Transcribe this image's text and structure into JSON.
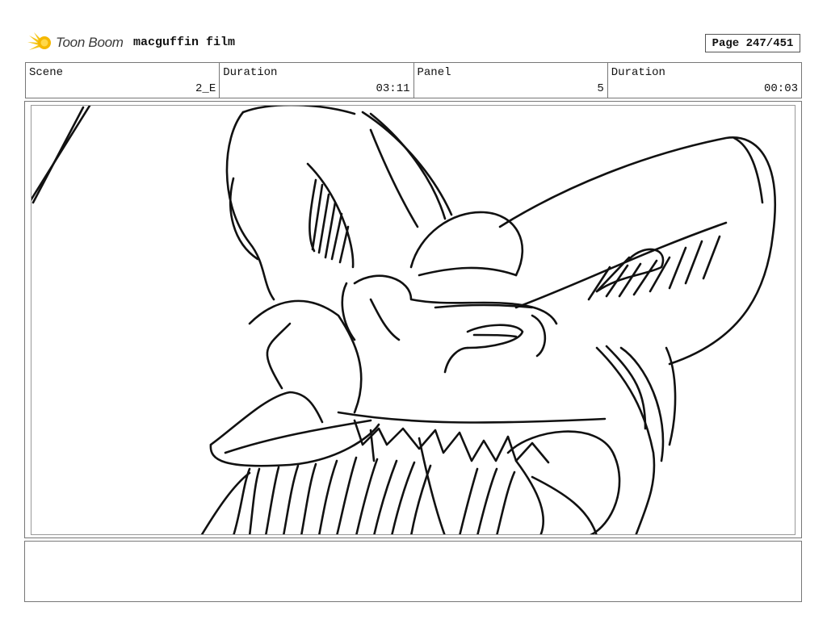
{
  "header": {
    "logo_text": "Toon Boom",
    "project_title": "macguffin film",
    "page_label": "Page 247/451"
  },
  "info": {
    "scene_label": "Scene",
    "scene_value": "2_E",
    "scene_duration_label": "Duration",
    "scene_duration_value": "03:11",
    "panel_label": "Panel",
    "panel_value": "5",
    "panel_duration_label": "Duration",
    "panel_duration_value": "00:03"
  },
  "colors": {
    "logo_accent": "#f5c518",
    "sketch_ink": "#111111"
  },
  "icons": {
    "logo": "toon-boom-starburst-icon"
  },
  "notes": ""
}
